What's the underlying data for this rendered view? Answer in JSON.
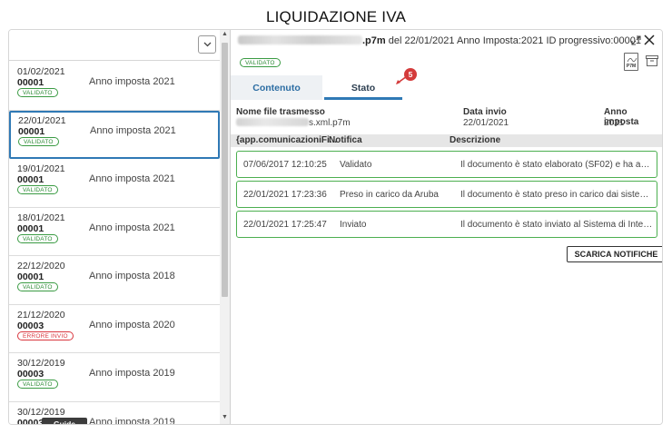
{
  "page_title": "LIQUIDAZIONE IVA",
  "list": {
    "items": [
      {
        "date": "01/02/2021",
        "number": "00001",
        "status": "VALIDATO",
        "status_type": "ok",
        "year": "Anno imposta 2021"
      },
      {
        "date": "22/01/2021",
        "number": "00001",
        "status": "VALIDATO",
        "status_type": "ok",
        "year": "Anno imposta 2021",
        "selected": true
      },
      {
        "date": "19/01/2021",
        "number": "00001",
        "status": "VALIDATO",
        "status_type": "ok",
        "year": "Anno imposta 2021"
      },
      {
        "date": "18/01/2021",
        "number": "00001",
        "status": "VALIDATO",
        "status_type": "ok",
        "year": "Anno imposta 2021"
      },
      {
        "date": "22/12/2020",
        "number": "00001",
        "status": "VALIDATO",
        "status_type": "ok",
        "year": "Anno imposta 2018"
      },
      {
        "date": "21/12/2020",
        "number": "00003",
        "status": "ERRORE INVIO",
        "status_type": "err",
        "year": "Anno imposta 2020"
      },
      {
        "date": "30/12/2019",
        "number": "00003",
        "status": "VALIDATO",
        "status_type": "ok",
        "year": "Anno imposta 2019"
      },
      {
        "date": "30/12/2019",
        "number": "00003",
        "status": "VALIDATO",
        "status_type": "ok",
        "year": "Anno imposta 2019"
      }
    ]
  },
  "guide_label": "Guide",
  "detail": {
    "file_ext": ".p7m",
    "file_info": " del 22/01/2021 Anno Imposta:2021 ID progressivo:00001",
    "status": "VALIDATO",
    "p7m_label": "P7M",
    "tabs": {
      "contenuto": "Contenuto",
      "stato": "Stato"
    },
    "step_number": "5",
    "meta": {
      "file_label": "Nome file trasmesso",
      "file_value_suffix": "s.xml.p7m",
      "date_label": "Data invio",
      "date_value": "22/01/2021",
      "year_label": "Anno imposta",
      "year_value": "2021"
    },
    "grid": {
      "headers": [
        "{app.comunicazioniFi...",
        "Notifica",
        "Descrizione"
      ],
      "rows": [
        {
          "datetime": "07/06/2017 12:10:25",
          "notifica": "Validato",
          "descrizione": "Il documento è stato elaborato (SF02) e ha avut..."
        },
        {
          "datetime": "22/01/2021 17:23:36",
          "notifica": "Preso in carico da Aruba",
          "descrizione": "Il documento è stato preso in carico dai sistemi d..."
        },
        {
          "datetime": "22/01/2021 17:25:47",
          "notifica": "Inviato",
          "descrizione": "Il documento è stato inviato al Sistema di Intersc..."
        }
      ]
    },
    "download_label": "SCARICA NOTIFICHE"
  },
  "colors": {
    "accent": "#2f79b5",
    "ok": "#3a9b43",
    "error": "#d9363e",
    "marker": "#d43b3b"
  }
}
